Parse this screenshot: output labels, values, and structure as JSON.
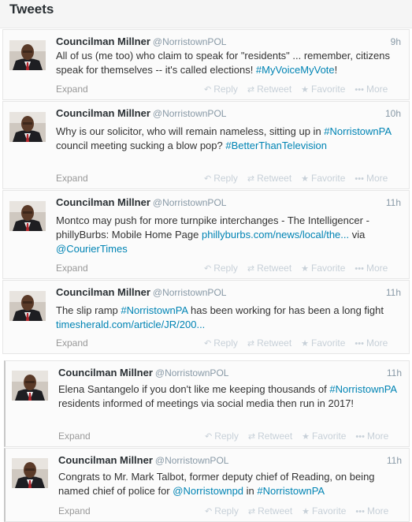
{
  "header": {
    "title": "Tweets"
  },
  "actions": {
    "reply": "Reply",
    "retweet": "Retweet",
    "favorite": "Favorite",
    "more": "More",
    "expand": "Expand"
  },
  "tweets": [
    {
      "name": "Councilman Millner",
      "handle": "@NorristownPOL",
      "time": "9h",
      "segments": [
        {
          "t": "All of us (me too) who claim to speak for \"residents\" ... remember, citizens speak for themselves -- it's called elections! "
        },
        {
          "t": "#MyVoiceMyVote",
          "link": true
        },
        {
          "t": "!"
        }
      ]
    },
    {
      "name": "Councilman Millner",
      "handle": "@NorristownPOL",
      "time": "10h",
      "segments": [
        {
          "t": "Why is our solicitor, who will remain nameless, sitting up in "
        },
        {
          "t": "#NorristownPA",
          "link": true
        },
        {
          "t": " council meeting sucking a blow pop? "
        },
        {
          "t": "#BetterThanTelevision",
          "link": true
        }
      ]
    },
    {
      "name": "Councilman Millner",
      "handle": "@NorristownPOL",
      "time": "11h",
      "segments": [
        {
          "t": "Montco may push for more turnpike interchanges - The Intelligencer - phillyBurbs: Mobile Home Page "
        },
        {
          "t": "phillyburbs.com/news/local/the...",
          "link": true
        },
        {
          "t": " via "
        },
        {
          "t": "@CourierTimes",
          "link": true
        }
      ]
    },
    {
      "name": "Councilman Millner",
      "handle": "@NorristownPOL",
      "time": "11h",
      "segments": [
        {
          "t": "The slip ramp "
        },
        {
          "t": "#NorristownPA",
          "link": true
        },
        {
          "t": " has been working for has been a long fight "
        },
        {
          "t": "timesherald.com/article/JR/200...",
          "link": true
        }
      ]
    },
    {
      "name": "Councilman Millner",
      "handle": "@NorristownPOL",
      "time": "11h",
      "segments": [
        {
          "t": "Elena Santangelo if you don't like me keeping thousands of "
        },
        {
          "t": "#NorristownPA",
          "link": true
        },
        {
          "t": " residents informed of meetings via social media then run in 2017!"
        }
      ]
    },
    {
      "name": "Councilman Millner",
      "handle": "@NorristownPOL",
      "time": "11h",
      "segments": [
        {
          "t": "Congrats to Mr. Mark Talbot, former deputy chief of Reading, on being named chief of police for "
        },
        {
          "t": "@Norristownpd",
          "link": true
        },
        {
          "t": " in "
        },
        {
          "t": "#NorristownPA",
          "link": true
        }
      ]
    }
  ]
}
